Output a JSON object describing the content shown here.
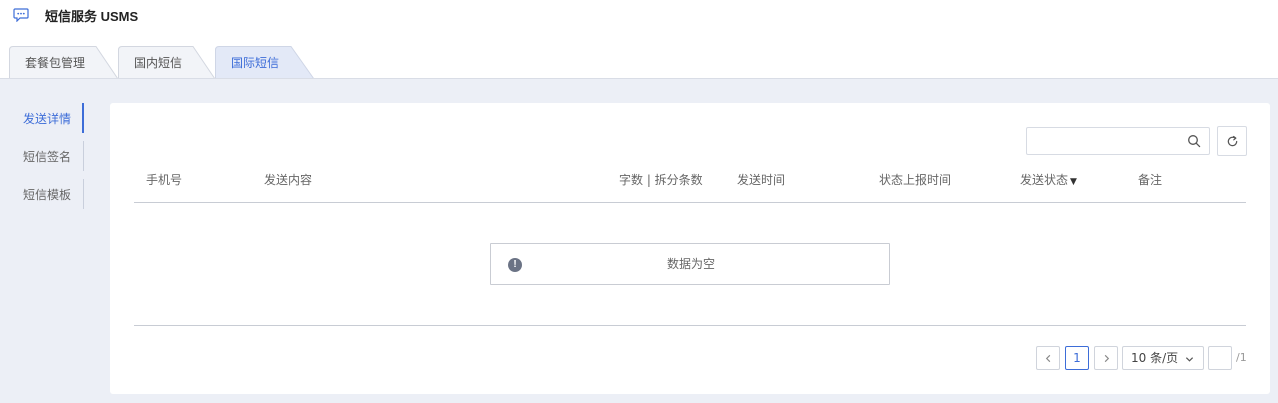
{
  "app": {
    "title": "短信服务 USMS",
    "icon": "chat-bubble-icon"
  },
  "tabs": [
    {
      "label": "套餐包管理",
      "active": false
    },
    {
      "label": "国内短信",
      "active": false
    },
    {
      "label": "国际短信",
      "active": true
    }
  ],
  "sidebar": {
    "items": [
      {
        "label": "发送详情",
        "active": true
      },
      {
        "label": "短信签名",
        "active": false
      },
      {
        "label": "短信模板",
        "active": false
      }
    ]
  },
  "search": {
    "value": "",
    "placeholder": ""
  },
  "table": {
    "columns": [
      {
        "label": "手机号"
      },
      {
        "label": "发送内容"
      },
      {
        "label": "字数 | 拆分条数"
      },
      {
        "label": "发送时间"
      },
      {
        "label": "状态上报时间"
      },
      {
        "label": "发送状态",
        "sortable": true
      },
      {
        "label": "备注"
      }
    ],
    "empty_text": "数据为空",
    "empty_icon": "!"
  },
  "pagination": {
    "current_page": "1",
    "page_size_label": "10 条/页",
    "jump_value": "",
    "total_label": "/1"
  },
  "colors": {
    "accent": "#3d6dd8",
    "background": "#eceff6"
  }
}
